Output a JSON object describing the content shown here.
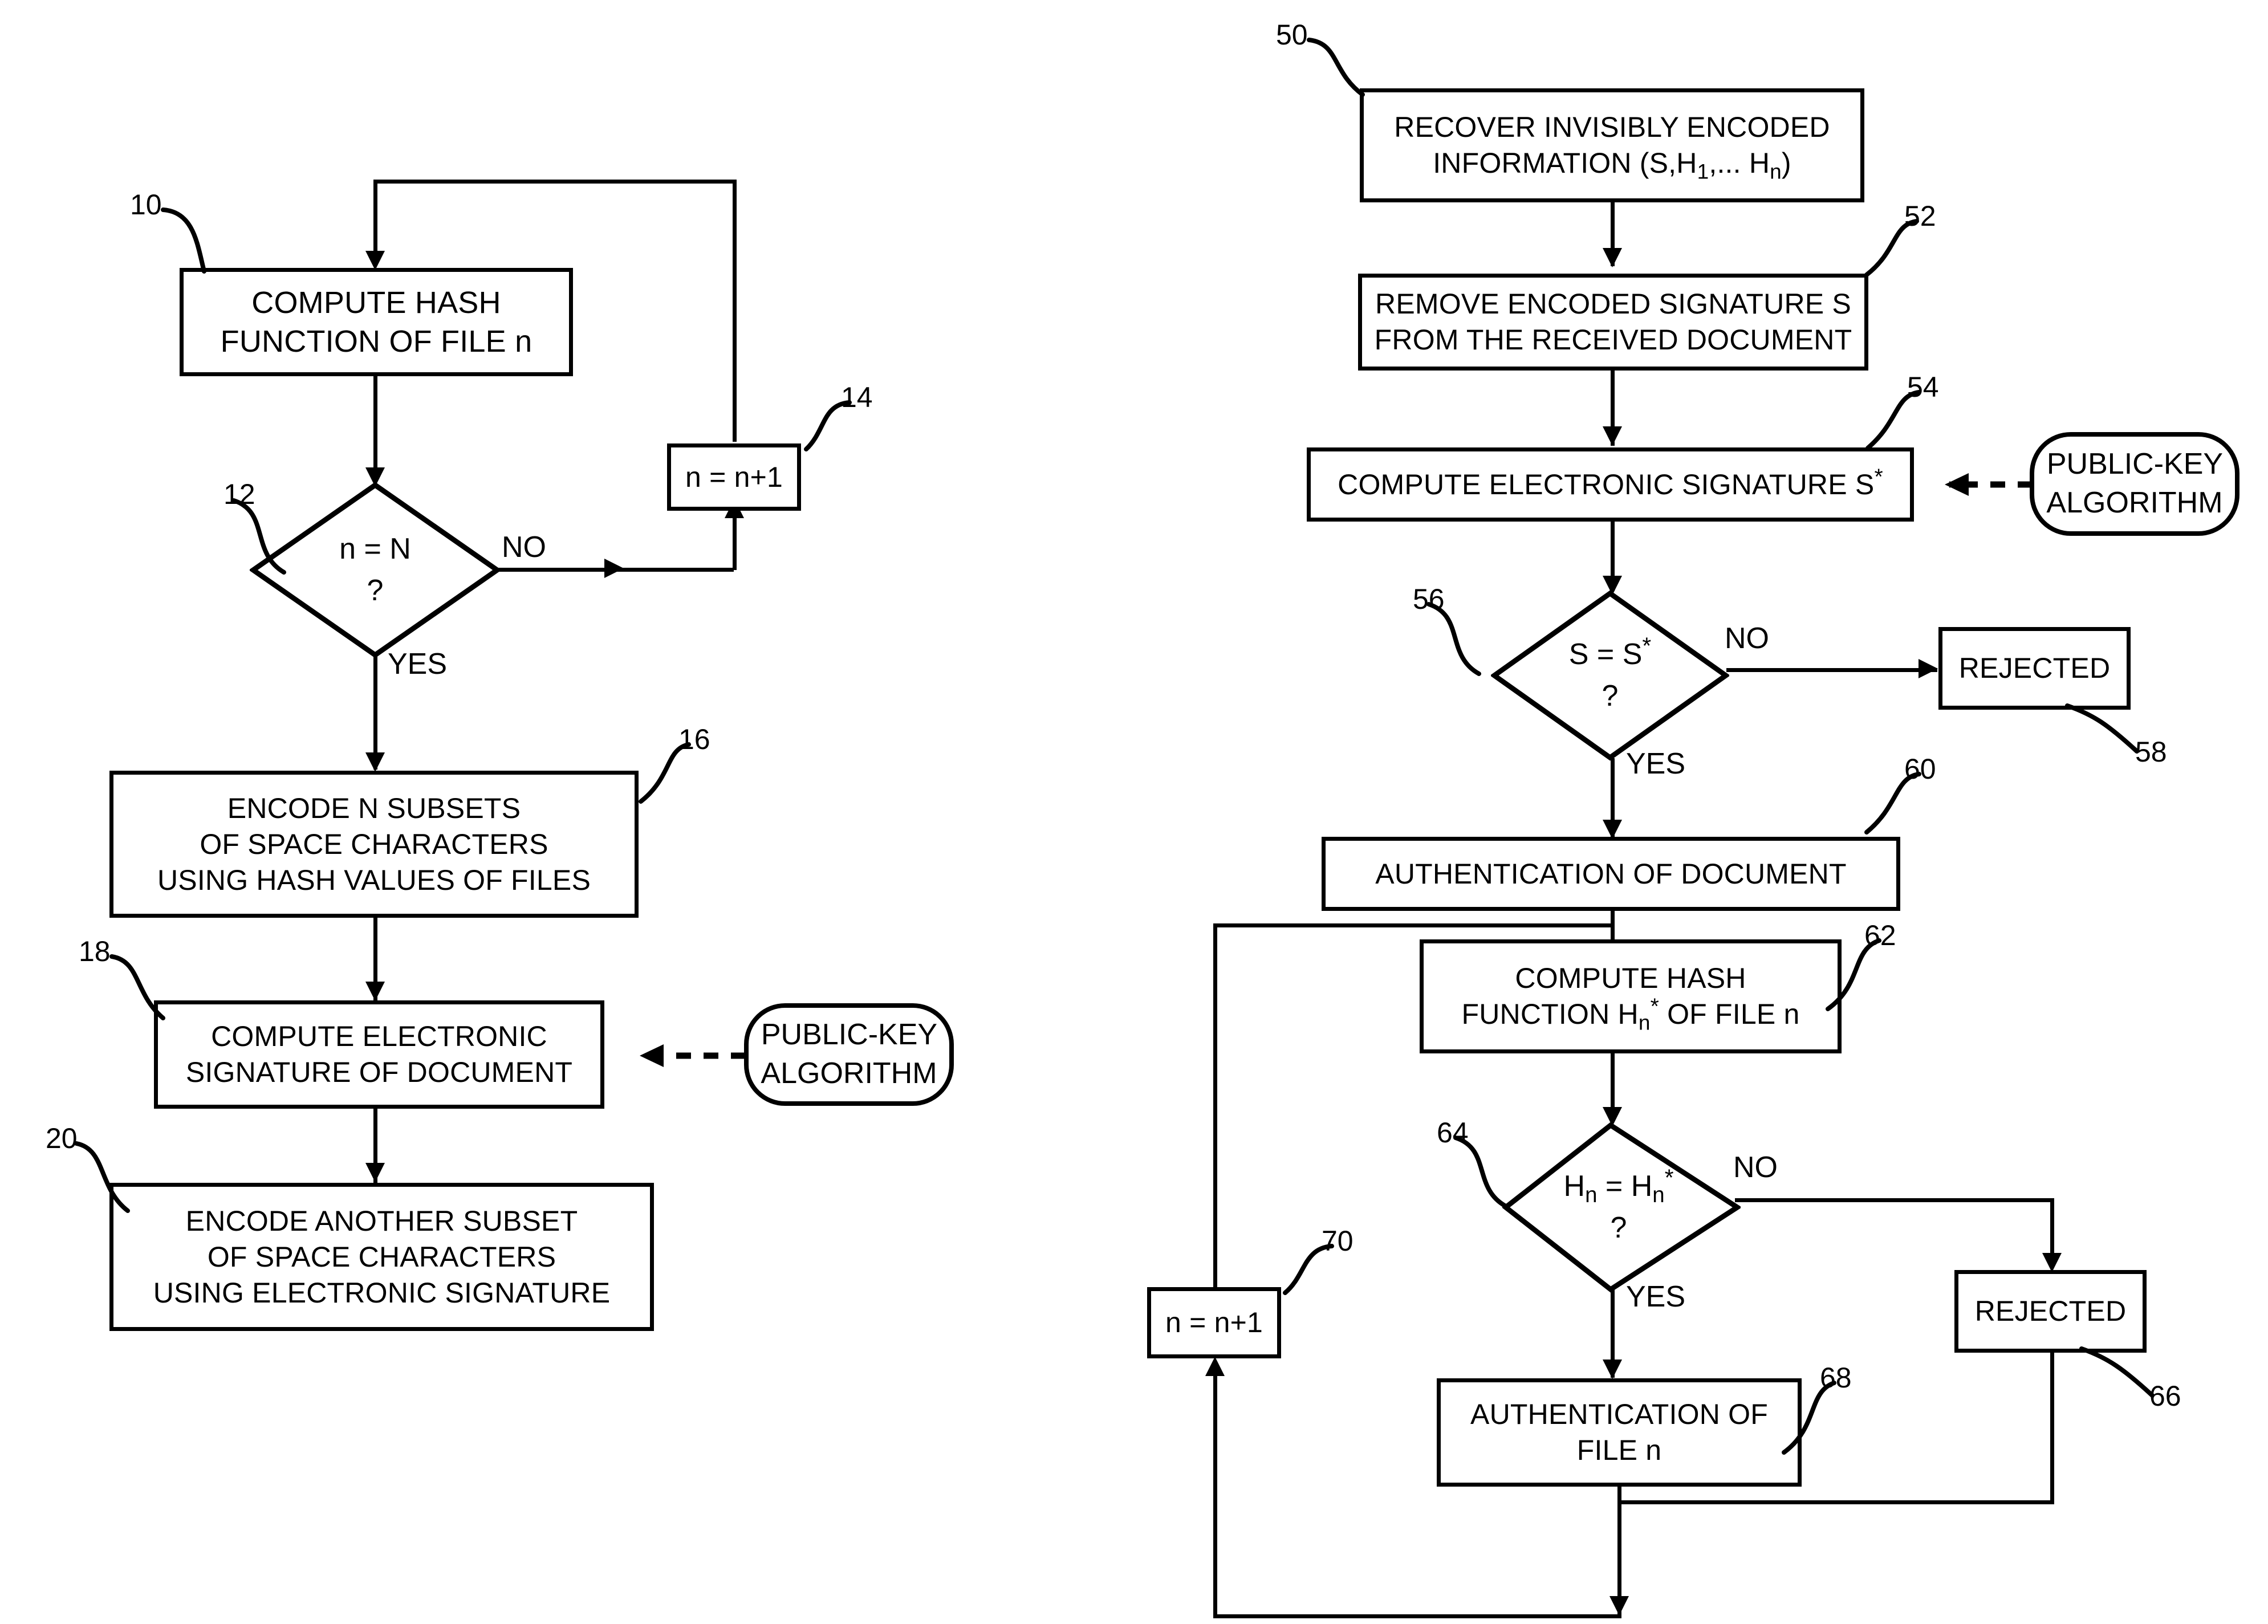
{
  "figure": {
    "kind": "patent-flowchart",
    "background": "#ffffff",
    "ink": "#000000"
  },
  "left_flow": {
    "nodes": [
      {
        "ref": "10",
        "shape": "process",
        "lines": [
          "COMPUTE HASH",
          "FUNCTION OF FILE n"
        ]
      },
      {
        "ref": "12",
        "shape": "decision",
        "lines": [
          "n = N",
          "?"
        ]
      },
      {
        "ref": "14",
        "shape": "process",
        "lines": [
          "n = n+1"
        ]
      },
      {
        "ref": "16",
        "shape": "process",
        "lines": [
          "ENCODE N SUBSETS",
          "OF SPACE CHARACTERS",
          "USING HASH VALUES OF FILES"
        ]
      },
      {
        "ref": "18",
        "shape": "process",
        "lines": [
          "COMPUTE ELECTRONIC",
          "SIGNATURE OF DOCUMENT"
        ]
      },
      {
        "ref": "20",
        "shape": "process",
        "lines": [
          "ENCODE ANOTHER SUBSET",
          "OF SPACE CHARACTERS",
          "USING ELECTRONIC SIGNATURE"
        ]
      }
    ],
    "annotation": {
      "shape": "oval",
      "lines": [
        "PUBLIC-KEY",
        "ALGORITHM"
      ]
    },
    "edge_labels": {
      "no": "NO",
      "yes": "YES"
    }
  },
  "right_flow": {
    "nodes": [
      {
        "ref": "50",
        "shape": "process",
        "lines": [
          "RECOVER INVISIBLY ENCODED",
          "INFORMATION (S,H1,... Hn)"
        ]
      },
      {
        "ref": "52",
        "shape": "process",
        "lines": [
          "REMOVE ENCODED SIGNATURE S",
          "FROM THE RECEIVED DOCUMENT"
        ]
      },
      {
        "ref": "54",
        "shape": "process",
        "lines": [
          "COMPUTE ELECTRONIC SIGNATURE S*"
        ]
      },
      {
        "ref": "56",
        "shape": "decision",
        "lines": [
          "S = S*",
          "?"
        ]
      },
      {
        "ref": "58",
        "shape": "process",
        "lines": [
          "REJECTED"
        ]
      },
      {
        "ref": "60",
        "shape": "process",
        "lines": [
          "AUTHENTICATION OF DOCUMENT"
        ]
      },
      {
        "ref": "62",
        "shape": "process",
        "lines": [
          "COMPUTE HASH",
          "FUNCTION Hn* OF FILE n"
        ]
      },
      {
        "ref": "64",
        "shape": "decision",
        "lines": [
          "Hn = Hn*",
          "?"
        ]
      },
      {
        "ref": "66",
        "shape": "process",
        "lines": [
          "REJECTED"
        ]
      },
      {
        "ref": "68",
        "shape": "process",
        "lines": [
          "AUTHENTICATION OF",
          "FILE n"
        ]
      },
      {
        "ref": "70",
        "shape": "process",
        "lines": [
          "n = n+1"
        ]
      }
    ],
    "annotation": {
      "shape": "oval",
      "lines": [
        "PUBLIC-KEY",
        "ALGORITHM"
      ]
    },
    "edge_labels": {
      "no_56": "NO",
      "yes_56": "YES",
      "no_64": "NO",
      "yes_64": "YES"
    }
  },
  "text": {
    "box10_l1": "COMPUTE HASH",
    "box10_l2": "FUNCTION OF FILE n",
    "dia12_l1": "n = N",
    "dia12_q": "?",
    "box14": "n = n+1",
    "box16_l1": "ENCODE N SUBSETS",
    "box16_l2": "OF SPACE CHARACTERS",
    "box16_l3": "USING HASH VALUES OF FILES",
    "box18_l1": "COMPUTE ELECTRONIC",
    "box18_l2": "SIGNATURE OF DOCUMENT",
    "box20_l1": "ENCODE ANOTHER SUBSET",
    "box20_l2": "OF SPACE CHARACTERS",
    "box20_l3": "USING ELECTRONIC SIGNATURE",
    "oval_left_l1": "PUBLIC-KEY",
    "oval_left_l2": "ALGORITHM",
    "box50_l1": "RECOVER INVISIBLY ENCODED",
    "box52_l1": "REMOVE ENCODED SIGNATURE S",
    "box52_l2": "FROM THE RECEIVED DOCUMENT",
    "box54": "COMPUTE ELECTRONIC SIGNATURE S",
    "box58": "REJECTED",
    "box60": "AUTHENTICATION OF DOCUMENT",
    "box62_l1": "COMPUTE HASH",
    "box66": "REJECTED",
    "box68_l1": "AUTHENTICATION OF",
    "box68_l2": "FILE n",
    "box70": "n = n+1",
    "oval_right_l1": "PUBLIC-KEY",
    "oval_right_l2": "ALGORITHM",
    "label_no": "NO",
    "label_yes": "YES"
  },
  "refs": {
    "r10": "10",
    "r12": "12",
    "r14": "14",
    "r16": "16",
    "r18": "18",
    "r20": "20",
    "r50": "50",
    "r52": "52",
    "r54": "54",
    "r56": "56",
    "r58": "58",
    "r60": "60",
    "r62": "62",
    "r64": "64",
    "r66": "66",
    "r68": "68",
    "r70": "70"
  }
}
